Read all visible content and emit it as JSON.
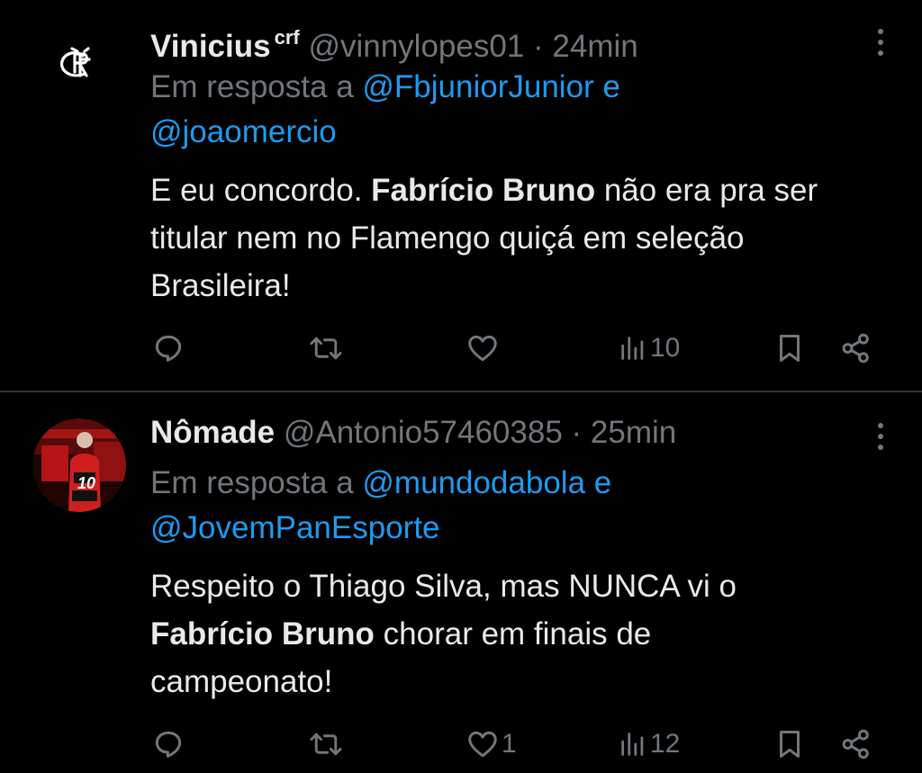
{
  "tweets": [
    {
      "name": "Vinicius",
      "name_suffix": "crf",
      "handle": "@vinnylopes01",
      "separator": "·",
      "time": "24min",
      "reply_prefix": "Em resposta a",
      "reply_mention_1": "@FbjuniorJunior",
      "reply_conjunction": "e",
      "reply_mention_2": "@joaomercio",
      "body_part_1": "E eu concordo.",
      "body_bold": "Fabrício Bruno",
      "body_part_2": "não era pra ser titular nem no Flamengo quiçá em seleção Brasileira!",
      "avatar": "flamengo-crf-logo",
      "likes": "",
      "views": "10"
    },
    {
      "name": "Nômade",
      "handle": "@Antonio57460385",
      "separator": "·",
      "time": "25min",
      "reply_prefix": "Em resposta a",
      "reply_mention_1": "@mundodabola",
      "reply_conjunction": "e",
      "reply_mention_2": "@JovemPanEsporte",
      "body_part_1": "Respeito o Thiago Silva, mas NUNCA vi o",
      "body_bold": "Fabrício Bruno",
      "body_part_2": "chorar em finais de campeonato!",
      "avatar": "player-number-10-photo",
      "likes": "1",
      "views": "12"
    }
  ],
  "colors": {
    "background": "#000000",
    "text": "#e7e9ea",
    "secondary": "#71767b",
    "link": "#1d9bf0",
    "divider": "#2f3336"
  }
}
